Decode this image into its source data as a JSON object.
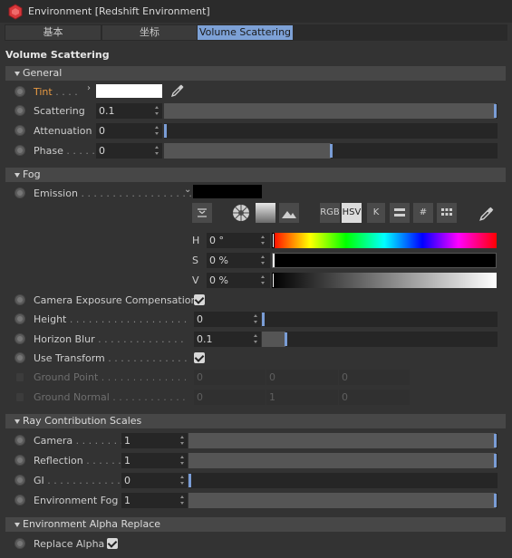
{
  "window": {
    "title": "Environment [Redshift Environment]"
  },
  "tabs": [
    {
      "label": "基本",
      "active": false
    },
    {
      "label": "坐标",
      "active": false
    },
    {
      "label": "Volume Scattering",
      "active": true
    }
  ],
  "section_title": "Volume Scattering",
  "general": {
    "group_label": "General",
    "tint": {
      "label": "Tint",
      "dots": " . . . .",
      "color": "#ffffff"
    },
    "scattering": {
      "label": "Scattering",
      "value": "0.1",
      "slider_fraction": 1.0
    },
    "attenuation": {
      "label": "Attenuation",
      "value": "0",
      "slider_fraction": 0.0
    },
    "phase": {
      "label": "Phase",
      "dots": " . . . . .",
      "value": "0",
      "slider_fraction": 0.5
    }
  },
  "fog": {
    "group_label": "Fog",
    "emission": {
      "label": "Emission",
      "dots": " . . . . . . . . . . . . . . . . . . .",
      "color": "#000000"
    },
    "color_buttons": [
      "RGB",
      "HSV",
      "K",
      "#"
    ],
    "active_color_mode": "HSV",
    "hsv": [
      {
        "label": "H",
        "value": "0 °"
      },
      {
        "label": "S",
        "value": "0 %"
      },
      {
        "label": "V",
        "value": "0 %"
      }
    ],
    "camera_exposure": {
      "label": "Camera Exposure Compensation",
      "checked": true
    },
    "height": {
      "label": "Height",
      "dots": " . . . . . . . . . . . . . . . . . . .",
      "value": "0",
      "slider_fraction": 0.0
    },
    "horizon_blur": {
      "label": "Horizon Blur",
      "dots": " . . . . . . . . . . . . . .",
      "value": "0.1",
      "slider_fraction": 0.1
    },
    "use_transform": {
      "label": "Use Transform",
      "dots": " . . . . . . . . . . . . .",
      "checked": true
    },
    "ground_point": {
      "label": "Ground Point",
      "dots": " . . . . . . . . . . . . . .",
      "values": [
        "0",
        "0",
        "0"
      ]
    },
    "ground_normal": {
      "label": "Ground Normal",
      "dots": " . . . . . . . . . . . .",
      "values": [
        "0",
        "1",
        "0"
      ]
    }
  },
  "ray_contribution": {
    "group_label": "Ray Contribution Scales",
    "items": [
      {
        "label": "Camera",
        "dots": " . . . . . . . . .",
        "value": "1",
        "slider_fraction": 1.0
      },
      {
        "label": "Reflection",
        "dots": " . . . . . . .",
        "value": "1",
        "slider_fraction": 1.0
      },
      {
        "label": "GI",
        "dots": " . . . . . . . . . . . . .",
        "value": "0",
        "slider_fraction": 0.0
      },
      {
        "label": "Environment Fog",
        "dots": "",
        "value": "1",
        "slider_fraction": 1.0
      }
    ]
  },
  "alpha_replace": {
    "group_label": "Environment Alpha Replace",
    "replace_alpha": {
      "label": "Replace Alpha",
      "checked": true
    }
  },
  "colors": {
    "accent": "#7da1d6",
    "tint_label": "#e89a43",
    "redshift_logo": "#d9373a"
  }
}
